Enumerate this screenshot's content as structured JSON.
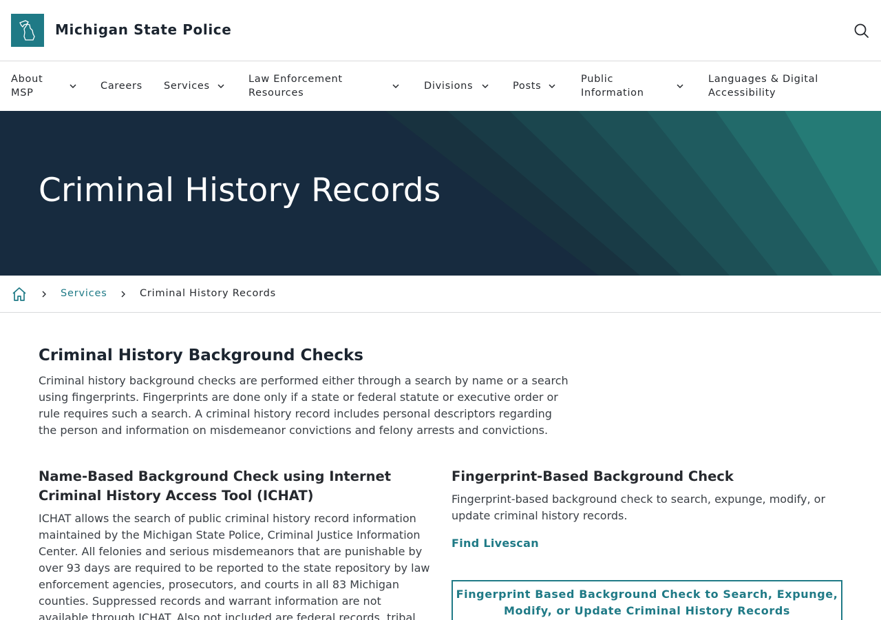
{
  "header": {
    "site_title": "Michigan State Police",
    "logo_icon": "michigan-state-outline-icon",
    "search_icon": "search-icon"
  },
  "nav": {
    "items": [
      {
        "line1": "About",
        "line2": "MSP",
        "has_dropdown": true
      },
      {
        "line1": "Careers",
        "line2": "",
        "has_dropdown": false
      },
      {
        "line1": "Services",
        "line2": "",
        "has_dropdown": true
      },
      {
        "line1": "Law Enforcement",
        "line2": "Resources",
        "has_dropdown": true
      },
      {
        "line1": "Divisions",
        "line2": "",
        "has_dropdown": true
      },
      {
        "line1": "Posts",
        "line2": "",
        "has_dropdown": true
      },
      {
        "line1": "Public",
        "line2": "Information",
        "has_dropdown": true
      },
      {
        "line1": "Languages & Digital",
        "line2": "Accessibility",
        "has_dropdown": false
      }
    ]
  },
  "hero": {
    "title": "Criminal History Records"
  },
  "breadcrumb": {
    "home_icon": "home-icon",
    "items": [
      "Services",
      "Criminal History Records"
    ]
  },
  "main": {
    "heading": "Criminal History Background Checks",
    "intro_lines": [
      "Criminal history background checks are performed either through a search by name or a search",
      "using fingerprints. Fingerprints are done only if a state or federal statute or executive order or",
      "rule requires such a search. A criminal history record includes personal descriptors regarding",
      "the person and information on misdemeanor convictions and felony arrests and convictions."
    ],
    "ichat": {
      "title_lines": [
        "Name-Based Background Check using Internet",
        "Criminal History Access Tool (ICHAT)"
      ],
      "body_lines": [
        "ICHAT allows the search of public criminal history record information",
        "maintained by the Michigan State Police, Criminal Justice Information",
        "Center. All felonies and serious misdemeanors that are punishable by",
        "over 93 days are required to be reported to the state repository by law",
        "enforcement agencies, prosecutors, and courts in all 83 Michigan",
        "counties. Suppressed records and warrant information are not",
        "available through ICHAT. Also not included are federal records, tribal"
      ]
    },
    "fingerprint": {
      "title": "Fingerprint-Based Background Check",
      "body_lines": [
        "Fingerprint-based background check to search, expunge, modify, or",
        "update criminal history records."
      ],
      "link": "Find Livescan",
      "button_lines": [
        "Fingerprint Based Background Check to Search, Expunge,",
        "Modify, or Update Criminal History Records"
      ]
    }
  },
  "colors": {
    "teal": "#1f7a86",
    "navy": "#172b3f",
    "text": "#26292e"
  }
}
